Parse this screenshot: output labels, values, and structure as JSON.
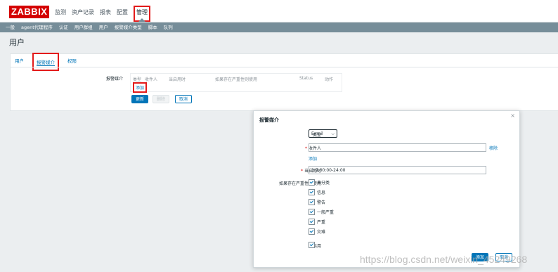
{
  "logo": "ZABBIX",
  "main_nav": [
    "监测",
    "资产记录",
    "报表",
    "配置",
    "管理"
  ],
  "sub_nav": [
    "一般",
    "agent代理程序",
    "认证",
    "用户群组",
    "用户",
    "报警媒介类型",
    "脚本",
    "队列"
  ],
  "page_title": "用户",
  "tabs": {
    "user": "用户",
    "media": "报警媒介",
    "perms": "权限"
  },
  "media_section": {
    "label": "报警媒介",
    "columns": [
      "类型",
      "收件人",
      "当启用时",
      "如果存在严重性则使用",
      "Status",
      "动作"
    ],
    "add_link": "添加"
  },
  "buttons": {
    "update": "更新",
    "delete": "删除",
    "cancel": "取消"
  },
  "modal": {
    "title": "报警媒介",
    "close": "×",
    "type_label": "类型",
    "type_value": "Email",
    "recipient_label": "收件人",
    "recipient_value": "",
    "remove_link": "移除",
    "add_link": "添加",
    "when_active_label": "当启用时",
    "when_active_value": "1-7,00:00-24:00",
    "severity_label": "如果存在严重性则使用",
    "severities": [
      "未分类",
      "信息",
      "警告",
      "一般严重",
      "严重",
      "灾难"
    ],
    "enabled_label": "已启用",
    "add_button": "添加",
    "cancel_button": "取消"
  },
  "watermark": "https://blog.csdn.net/weixin_45249268",
  "colors": {
    "brand": "#d40000",
    "accent": "#0275b8",
    "subnav": "#768d99",
    "highlight": "#e31b1b"
  }
}
